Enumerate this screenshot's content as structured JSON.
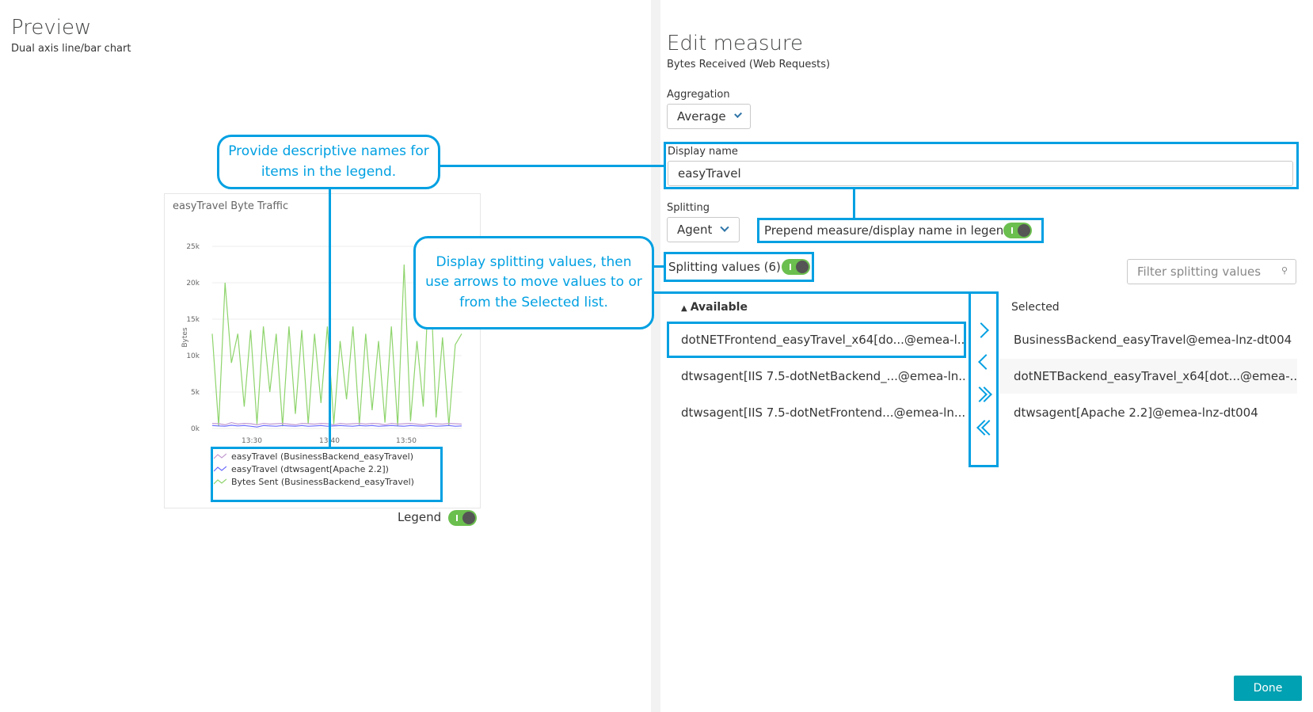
{
  "preview": {
    "title": "Preview",
    "subtitle": "Dual axis line/bar chart",
    "legend_toggle_label": "Legend"
  },
  "chart_data": {
    "type": "line",
    "title": "easyTravel Byte Traffic",
    "ylabel": "Bytes",
    "xlabel": "",
    "yticks": [
      "25k",
      "20k",
      "15k",
      "10k",
      "5k",
      "0k"
    ],
    "xticks": [
      "13:30",
      "13:40",
      "13:50"
    ],
    "ylim": [
      0,
      25000
    ],
    "series": [
      {
        "name": "easyTravel (BusinessBackend_easyTravel)",
        "color": "#c39bd3",
        "values": [
          700,
          650,
          500,
          800,
          600,
          700,
          650,
          500,
          700,
          600,
          650,
          700,
          600,
          500,
          700,
          650,
          600,
          700,
          650,
          500,
          700,
          600,
          650,
          700,
          600,
          700,
          650,
          500,
          700,
          600,
          650,
          700,
          600,
          500,
          700,
          650,
          600,
          700,
          650,
          600
        ]
      },
      {
        "name": "easyTravel (dtwsagent[Apache 2.2])",
        "color": "#6a6aff",
        "values": [
          400,
          350,
          300,
          450,
          350,
          400,
          300,
          200,
          400,
          350,
          300,
          400,
          350,
          300,
          400,
          300,
          350,
          400,
          300,
          350,
          400,
          350,
          300,
          400,
          350,
          400,
          300,
          350,
          400,
          350,
          300,
          400,
          350,
          300,
          400,
          300,
          350,
          400,
          300,
          350
        ]
      },
      {
        "name": "Bytes Sent (BusinessBackend_easyTravel)",
        "color": "#8ed46c",
        "values": [
          13000,
          300,
          20000,
          9000,
          13000,
          3000,
          13500,
          600,
          14000,
          5000,
          13000,
          300,
          14000,
          2000,
          13500,
          600,
          13000,
          3500,
          14000,
          600,
          12000,
          4000,
          14000,
          500,
          13000,
          2500,
          12000,
          800,
          14000,
          300,
          22500,
          1000,
          12000,
          3000,
          23000,
          1500,
          12500,
          400,
          11500,
          13000
        ]
      }
    ]
  },
  "callouts": {
    "legend_names": "Provide descriptive names for items in the legend.",
    "splitting_values": "Display splitting values, then use arrows to move values to or from the Selected list."
  },
  "edit": {
    "title": "Edit measure",
    "subtitle": "Bytes Received (Web Requests)",
    "aggregation_label": "Aggregation",
    "aggregation_value": "Average",
    "display_name_label": "Display name",
    "display_name_value": "easyTravel",
    "splitting_label": "Splitting",
    "splitting_value": "Agent",
    "prepend_label": "Prepend measure/display name in legend",
    "splitting_values_label": "Splitting values (6)",
    "filter_placeholder": "Filter splitting values",
    "available_header": "Available",
    "selected_header": "Selected",
    "available": [
      "dotNETFrontend_easyTravel_x64[do...@emea-l...",
      "dtwsagent[IIS 7.5-dotNetBackend_...@emea-ln...",
      "dtwsagent[IIS 7.5-dotNetFrontend...@emea-ln..."
    ],
    "selected": [
      "BusinessBackend_easyTravel@emea-lnz-dt004",
      "dotNETBackend_easyTravel_x64[dot...@emea-...",
      "dtwsagent[Apache 2.2]@emea-lnz-dt004"
    ],
    "done_label": "Done"
  }
}
